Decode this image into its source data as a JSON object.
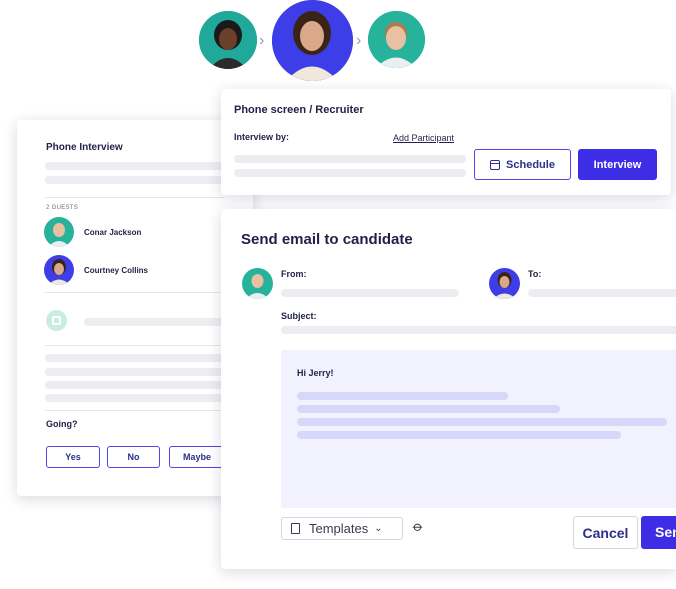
{
  "participants": [
    {
      "name": "candidate-1",
      "bg": "#20a99a"
    },
    {
      "name": "candidate-2",
      "bg": "#3d3ee8"
    },
    {
      "name": "candidate-3",
      "bg": "#27b39b"
    }
  ],
  "interview_card": {
    "title": "Phone Interview",
    "guests_label": "2 GUESTS",
    "guests": [
      {
        "name": "Conar Jackson"
      },
      {
        "name": "Courtney Collins"
      }
    ],
    "going_label": "Going?",
    "yes_label": "Yes",
    "no_label": "No",
    "maybe_label": "Maybe"
  },
  "phone_screen_card": {
    "title": "Phone screen / Recruiter",
    "interview_by_label": "Interview by:",
    "add_participant_label": "Add Participant",
    "schedule_label": "Schedule",
    "interview_label": "Interview"
  },
  "email_card": {
    "title": "Send email to candidate",
    "from_label": "From:",
    "to_label": "To:",
    "subject_label": "Subject:",
    "greeting": "Hi Jerry!",
    "templates_label": "Templates",
    "cancel_label": "Cancel",
    "send_label": "Send"
  },
  "colors": {
    "accent": "#3d2ee6",
    "navy": "#1f2147",
    "placeholder_bar": "#ececf1",
    "email_body_bg": "#f1f2fd"
  }
}
